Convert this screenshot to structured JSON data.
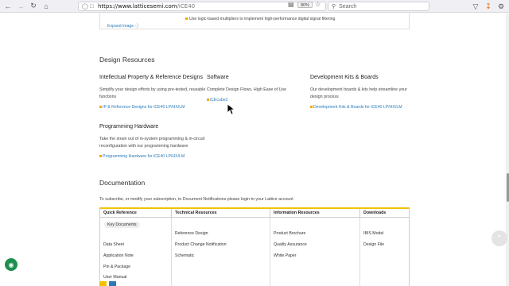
{
  "browser": {
    "url_host": "https://www.latticesemi.com",
    "url_path": "/iCE40",
    "zoom": "80%",
    "search_placeholder": "Search"
  },
  "prev_section": {
    "bullet_text": "Use logic-based multipliers to implement high-performance digital signal filtering",
    "expand_label": "Expand image"
  },
  "design_resources": {
    "heading": "Design Resources",
    "ip": {
      "title": "Intellectual Property & Reference Designs",
      "desc_line1": "Simplify your design efforts by using pre-tested, reusable",
      "desc_line2": "functions",
      "link": "IP & Reference Designs for iCE40 LP/HX/LM"
    },
    "software": {
      "title": "Software",
      "desc": "Complete Design Flows, High Ease of Use",
      "link": "iCEcube2"
    },
    "devkits": {
      "title": "Development Kits & Boards",
      "desc_line1": "Our development boards & kits help streamline your",
      "desc_line2": "design process",
      "link": "Development Kits & Boards for iCE40 LP/HX/LM"
    },
    "programming": {
      "title": "Programming Hardware",
      "desc_line1": "Take the strain out of in-system programming & in-circuit",
      "desc_line2": "reconfiguration with our programming hardware",
      "link": "Programming Hardware for iCE40 LP/HX/LM"
    }
  },
  "documentation": {
    "heading": "Documentation",
    "notice": "To subscribe, or modify your subscription, to Document Notifications please login to your Lattice account",
    "columns": [
      {
        "header": "Quick Reference",
        "items": [
          "Key Documents",
          "Data Sheet",
          "Application Note",
          "Pin & Package",
          "User Manual"
        ]
      },
      {
        "header": "Technical Resources",
        "items": [
          "Reference Design",
          "Product Change Notification",
          "Schematic"
        ]
      },
      {
        "header": "Information Resources",
        "items": [
          "Product Brochure",
          "Quality Assurance",
          "White Paper"
        ]
      },
      {
        "header": "Downloads",
        "items": [
          "IBIS Model",
          "Design File"
        ]
      }
    ]
  },
  "colors": {
    "accent_yellow": "#f2c200",
    "link_blue": "#2a7ab8",
    "chat_green": "#1d8f4f"
  }
}
